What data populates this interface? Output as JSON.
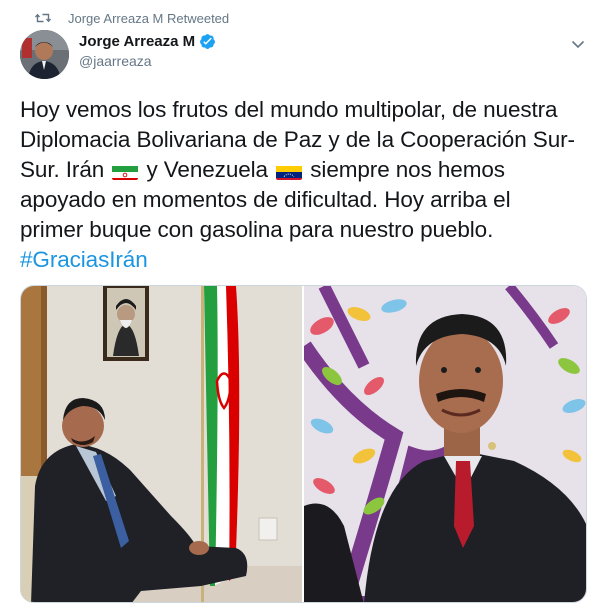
{
  "retweet": {
    "icon": "retweet-icon",
    "label": "Jorge Arreaza M Retweeted"
  },
  "author": {
    "display_name": "Jorge Arreaza M",
    "handle": "@jaarreaza",
    "verified": true,
    "avatar_icon": "avatar"
  },
  "tweet": {
    "lines": [
      "Hoy vemos los frutos del mundo multipolar, de nuestra",
      "Diplomacia Bolivariana de Paz y de la Cooperación Sur-",
      "Sur. Irán",
      "y Venezuela",
      "siempre nos hemos",
      "apoyado en momentos de dificultad. Hoy arriba el",
      "primer buque con gasolina para nuestro pueblo."
    ],
    "hashtag": "#GraciasIrán",
    "emoji": [
      "iran-flag",
      "venezuela-flag"
    ]
  },
  "media": {
    "photos": [
      "photo-meeting-iran-flag",
      "photo-portrait"
    ]
  },
  "colors": {
    "text": "#14171a",
    "secondary": "#657786",
    "link": "#1b95e0",
    "verified": "#1da1f2",
    "border": "#ccd6dd"
  }
}
